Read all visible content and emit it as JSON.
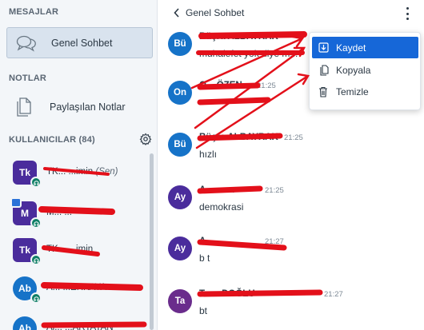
{
  "sidebar": {
    "messages_title": "MESAJLAR",
    "public_chat_label": "Genel Sohbet",
    "notes_title": "NOTLAR",
    "shared_notes_label": "Paylaşılan Notlar",
    "users_title": "KULLANICILAR (84)",
    "users": [
      {
        "initials": "Tk",
        "name": "TK... ...imin",
        "suffix": "(Sen)",
        "color": "#4a2c9c"
      },
      {
        "initials": "M",
        "name": "M... ...",
        "suffix": "",
        "color": "#4a2c9c",
        "presenter": true
      },
      {
        "initials": "Tk",
        "name": "TK... ...imin",
        "suffix": "",
        "color": "#4a2c9c"
      },
      {
        "initials": "Ab",
        "name": "A... ...ERKAYA",
        "suffix": "",
        "color": "#1673c8"
      },
      {
        "initials": "Ab",
        "name": "Al... ...ARTATAN",
        "suffix": "",
        "color": "#1673c8"
      }
    ]
  },
  "chat": {
    "title": "Genel Sohbet",
    "messages": [
      {
        "initials": "Bü",
        "sender": "Büşra ALBAYRAK",
        "time": "",
        "text": "muhalefet yok diye m...",
        "color": "#1673c8"
      },
      {
        "initials": "On",
        "sender": "O... ÖZEN",
        "time": "21:25",
        "text": "",
        "color": "#1673c8"
      },
      {
        "initials": "Bü",
        "sender": "Büşra ALBAYRAK",
        "time": "21:25",
        "text": "hızlı",
        "color": "#1673c8"
      },
      {
        "initials": "Ay",
        "sender": "A... ...ca",
        "time": "21:25",
        "text": "demokrasi",
        "color": "#4a2c9c"
      },
      {
        "initials": "Ay",
        "sender": "A... ...",
        "time": "21:27",
        "text": "b t",
        "color": "#4a2c9c"
      },
      {
        "initials": "Ta",
        "sender": "T... ...DOĞLU",
        "time": "21:27",
        "text": "bt",
        "color": "#6a2c8c"
      }
    ]
  },
  "menu": {
    "items": [
      {
        "label": "Kaydet",
        "icon": "save-icon"
      },
      {
        "label": "Kopyala",
        "icon": "copy-icon"
      },
      {
        "label": "Temizle",
        "icon": "trash-icon"
      }
    ]
  },
  "colors": {
    "accent": "#1667d8",
    "annotation": "#e3101a"
  }
}
